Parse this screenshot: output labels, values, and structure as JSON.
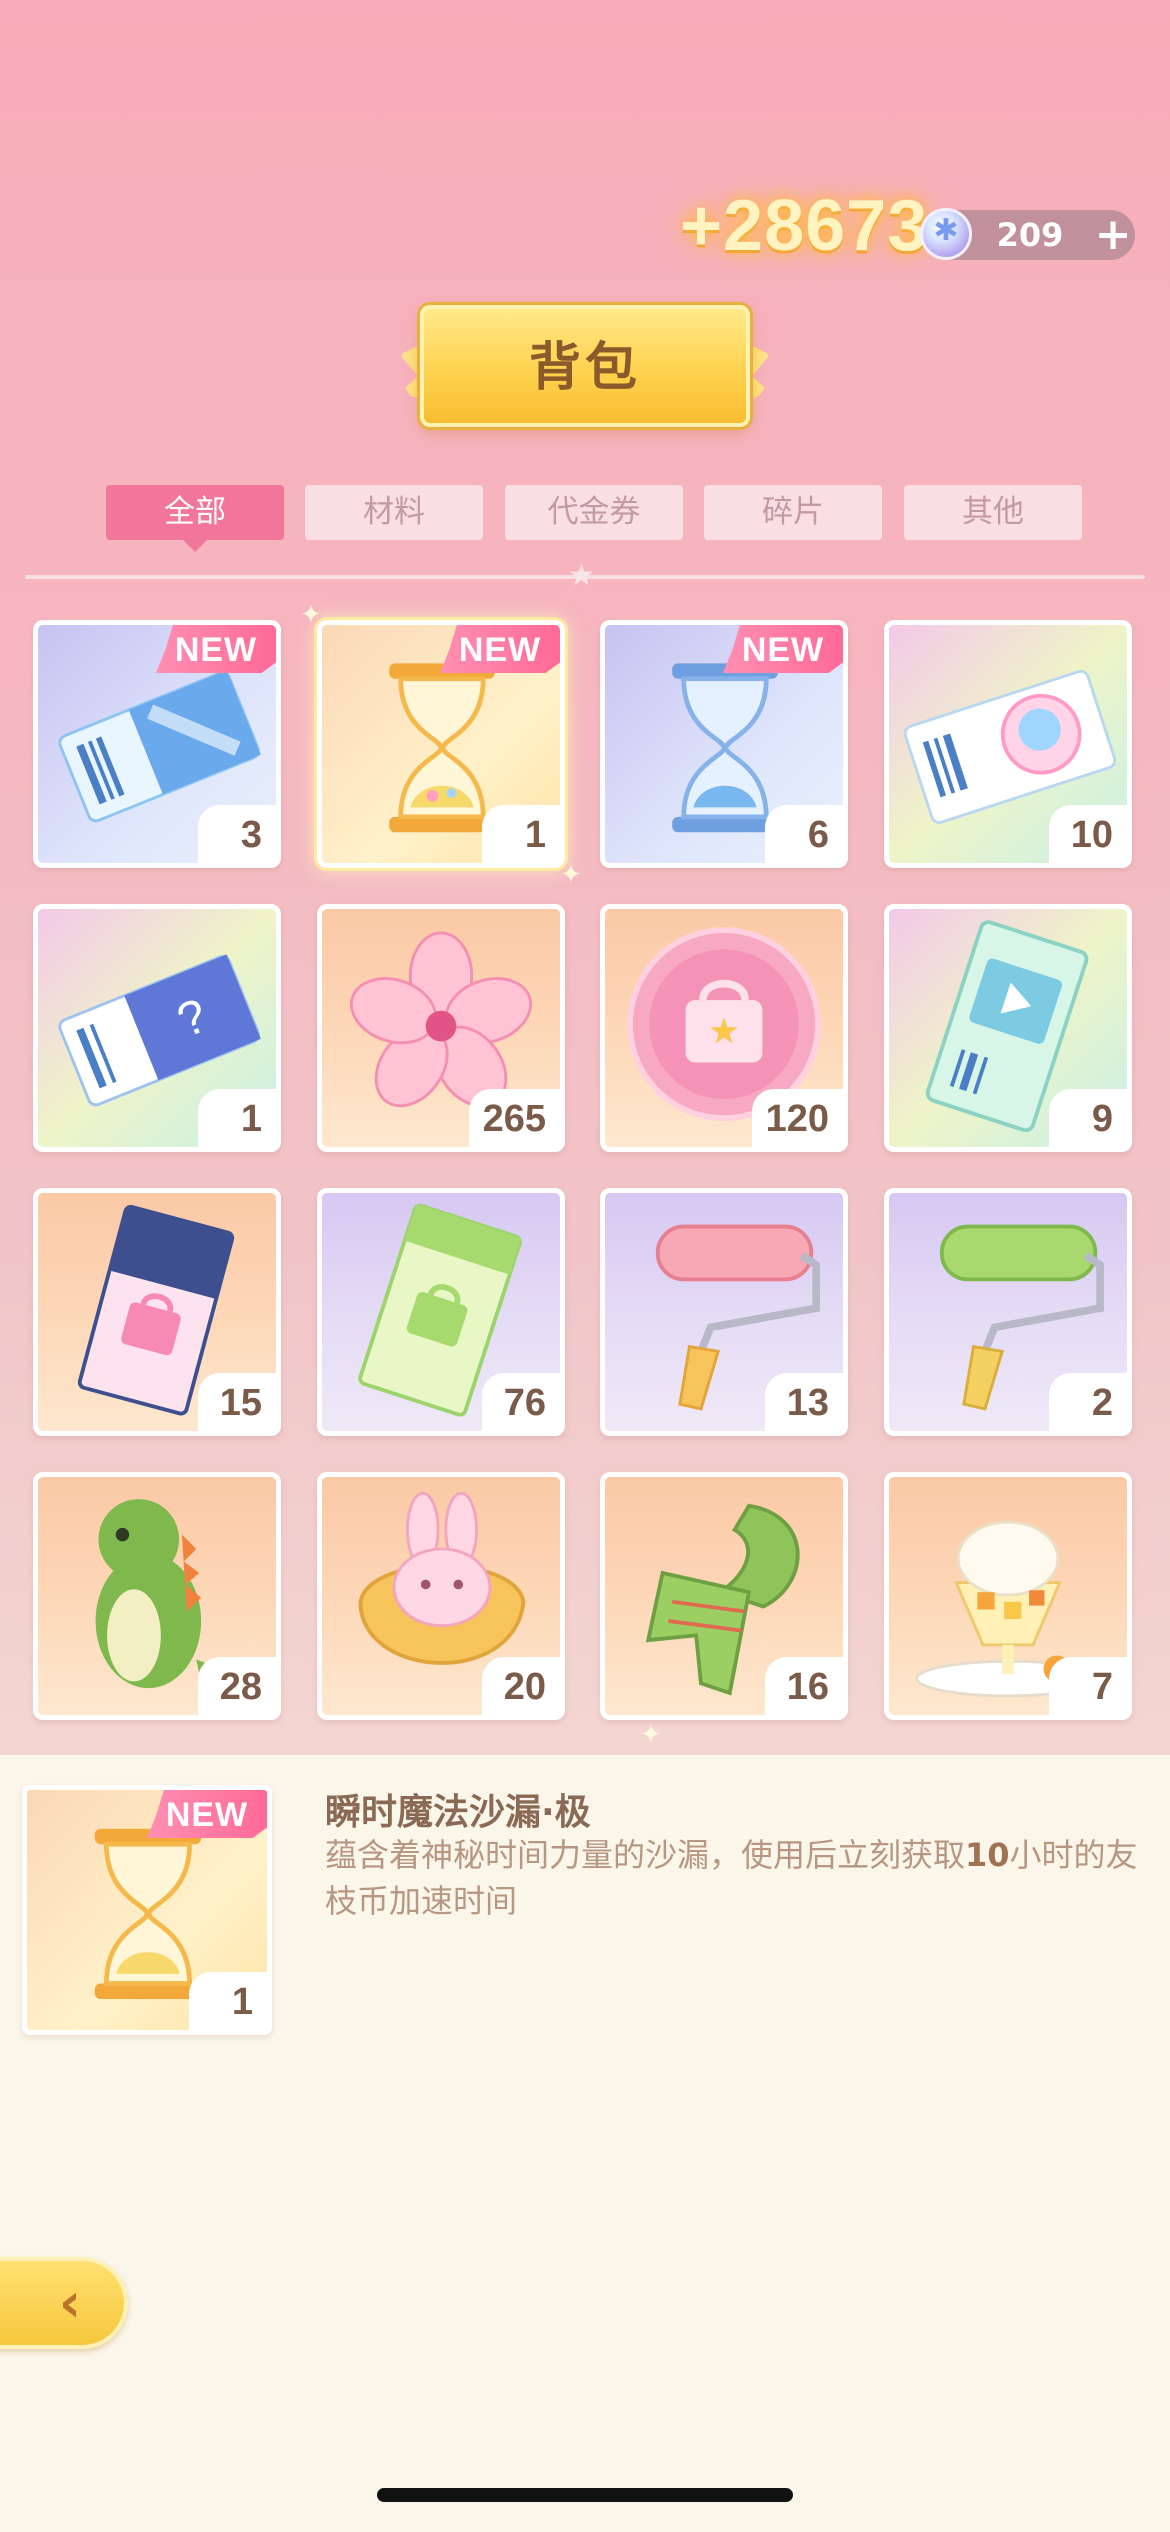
{
  "header": {
    "gain_text": "+28673",
    "currency_value": "209",
    "add_label": "+",
    "title": "背包"
  },
  "tabs": [
    {
      "label": "全部",
      "active": true
    },
    {
      "label": "材料",
      "active": false
    },
    {
      "label": "代金券",
      "active": false
    },
    {
      "label": "碎片",
      "active": false
    },
    {
      "label": "其他",
      "active": false
    }
  ],
  "items": [
    {
      "name": "voucher-ticket-blue",
      "icon": "blue-ticket-icon",
      "count": "3",
      "new": true,
      "badge": "NEW"
    },
    {
      "name": "magic-hourglass-gold",
      "icon": "gold-hourglass-icon",
      "count": "1",
      "new": true,
      "badge": "NEW",
      "selected": true
    },
    {
      "name": "magic-hourglass-blue",
      "icon": "blue-hourglass-icon",
      "count": "6",
      "new": true,
      "badge": "NEW"
    },
    {
      "name": "avatar-ticket",
      "icon": "rainbow-avatar-ticket-icon",
      "count": "10",
      "new": false
    },
    {
      "name": "mystery-ticket",
      "icon": "mystery-ticket-icon",
      "count": "1",
      "new": false
    },
    {
      "name": "sakura-flower",
      "icon": "sakura-flower-icon",
      "count": "265",
      "new": false
    },
    {
      "name": "bag-coin",
      "icon": "bag-coin-icon",
      "count": "120",
      "new": false
    },
    {
      "name": "video-ticket",
      "icon": "video-ticket-icon",
      "count": "9",
      "new": false
    },
    {
      "name": "pink-bag-ticket",
      "icon": "pink-bag-ticket-icon",
      "count": "15",
      "new": false
    },
    {
      "name": "green-bag-ticket",
      "icon": "green-bag-ticket-icon",
      "count": "76",
      "new": false
    },
    {
      "name": "pink-paint-roller",
      "icon": "pink-roller-icon",
      "count": "13",
      "new": false
    },
    {
      "name": "green-paint-roller",
      "icon": "green-roller-icon",
      "count": "2",
      "new": false
    },
    {
      "name": "green-dinosaur",
      "icon": "dinosaur-icon",
      "count": "28",
      "new": false
    },
    {
      "name": "bunny-pouch",
      "icon": "bunny-pouch-icon",
      "count": "20",
      "new": false
    },
    {
      "name": "green-scarf",
      "icon": "scarf-icon",
      "count": "16",
      "new": false
    },
    {
      "name": "parfait",
      "icon": "parfait-icon",
      "count": "7",
      "new": false
    }
  ],
  "detail": {
    "title": "瞬时魔法沙漏·极",
    "desc_part1": "蕴含着神秘时间力量的沙漏，使用后立刻获取",
    "desc_highlight": "10",
    "desc_part2": "小时的友枝币加速时间",
    "count": "1",
    "badge": "NEW"
  },
  "colors": {
    "accent_pink": "#f2759a",
    "tab_inactive": "#f9dfe3",
    "gold": "#ffd24e",
    "text_brown": "#8a6a55"
  }
}
